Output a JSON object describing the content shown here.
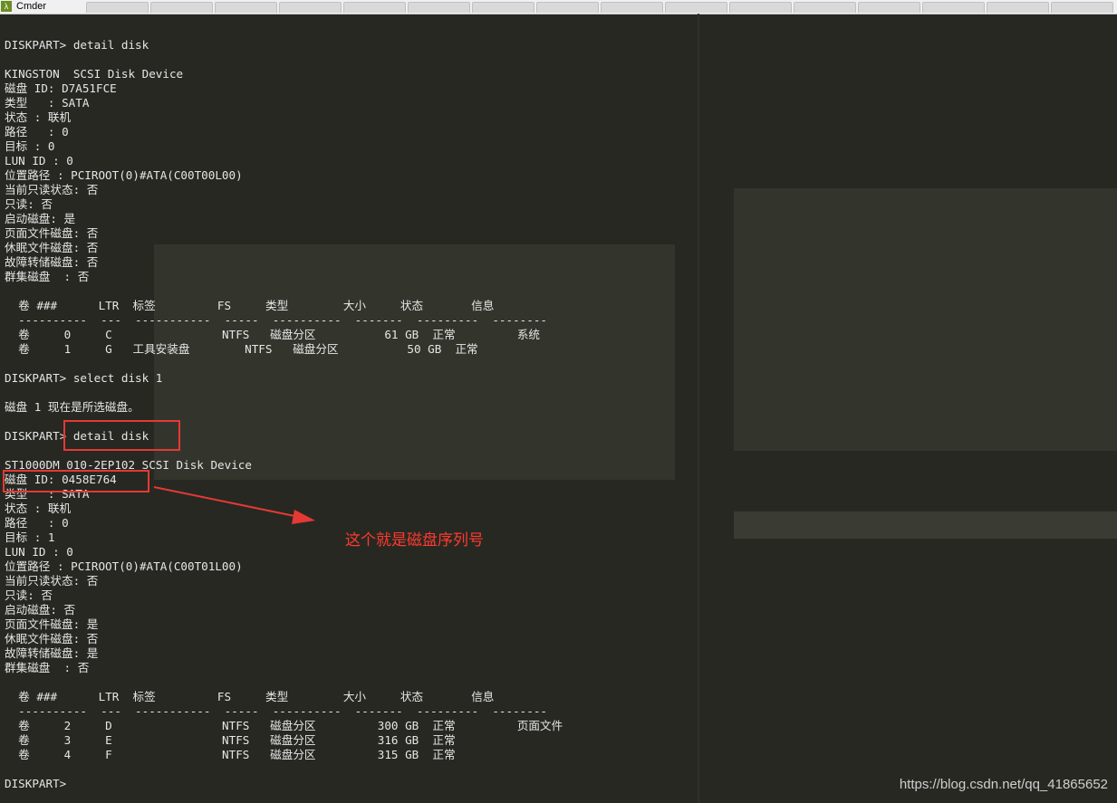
{
  "window": {
    "title": "Cmder",
    "icon": "cmder-lambda-icon"
  },
  "terminal_lines": [
    "DISKPART> detail disk",
    "",
    "KINGSTON  SCSI Disk Device",
    "磁盘 ID: D7A51FCE",
    "类型   : SATA",
    "状态 : 联机",
    "路径   : 0",
    "目标 : 0",
    "LUN ID : 0",
    "位置路径 : PCIROOT(0)#ATA(C00T00L00)",
    "当前只读状态: 否",
    "只读: 否",
    "启动磁盘: 是",
    "页面文件磁盘: 否",
    "休眠文件磁盘: 否",
    "故障转储磁盘: 否",
    "群集磁盘  : 否",
    "",
    "  卷 ###      LTR  标签         FS     类型        大小     状态       信息",
    "  ----------  ---  -----------  -----  ----------  -------  ---------  --------",
    "  卷     0     C                NTFS   磁盘分区          61 GB  正常         系统",
    "  卷     1     G   工具安装盘        NTFS   磁盘分区          50 GB  正常",
    "",
    "DISKPART> select disk 1",
    "",
    "磁盘 1 现在是所选磁盘。",
    "",
    "DISKPART> detail disk",
    "",
    "ST1000DM 010-2EP102 SCSI Disk Device",
    "磁盘 ID: 0458E764",
    "类型   : SATA",
    "状态 : 联机",
    "路径   : 0",
    "目标 : 1",
    "LUN ID : 0",
    "位置路径 : PCIROOT(0)#ATA(C00T01L00)",
    "当前只读状态: 否",
    "只读: 否",
    "启动磁盘: 否",
    "页面文件磁盘: 是",
    "休眠文件磁盘: 否",
    "故障转储磁盘: 是",
    "群集磁盘  : 否",
    "",
    "  卷 ###      LTR  标签         FS     类型        大小     状态       信息",
    "  ----------  ---  -----------  -----  ----------  -------  ---------  --------",
    "  卷     2     D                NTFS   磁盘分区         300 GB  正常         页面文件",
    "  卷     3     E                NTFS   磁盘分区         316 GB  正常",
    "  卷     4     F                NTFS   磁盘分区         315 GB  正常",
    "",
    "DISKPART> "
  ],
  "annotation": {
    "note": "这个就是磁盘序列号",
    "color": "#e53935"
  },
  "watermark": "https://blog.csdn.net/qq_41865652"
}
